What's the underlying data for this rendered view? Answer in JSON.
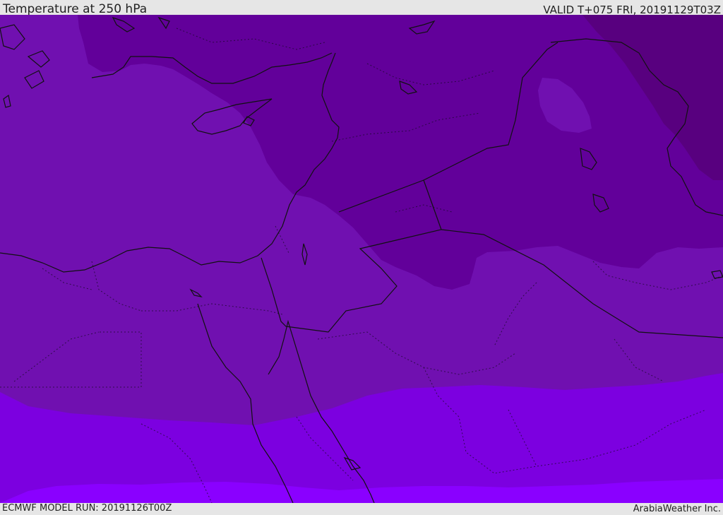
{
  "header": {
    "title": "Temperature at 250 hPa",
    "valid_time": "VALID T+075 FRI, 20191129T03Z"
  },
  "footer": {
    "model_run": "ECMWF MODEL RUN: 20191126T00Z",
    "credit": "ArabiaWeather Inc."
  },
  "map": {
    "field": "temperature",
    "pressure_level_hpa": 250,
    "palette": {
      "darkest_band": "#58007f",
      "dark_band": "#62009a",
      "mid_band": "#7010b0",
      "light_band": "#7c00e0",
      "lightest_band": "#8a00ff",
      "coastline": "#111111",
      "border_dotted": "#1a0a2a"
    }
  }
}
